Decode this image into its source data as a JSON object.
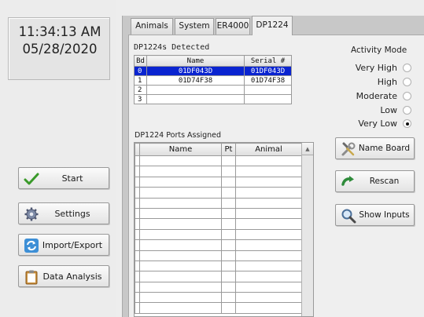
{
  "clock": {
    "time": "11:34:13 AM",
    "date": "05/28/2020"
  },
  "left_buttons": [
    {
      "label": "Start",
      "icon": "check-icon"
    },
    {
      "label": "Settings",
      "icon": "gear-icon"
    },
    {
      "label": "Import/Export",
      "icon": "sync-icon"
    },
    {
      "label": "Data Analysis",
      "icon": "clipboard-icon"
    }
  ],
  "tabs": [
    {
      "label": "Animals"
    },
    {
      "label": "System"
    },
    {
      "label": "ER4000"
    },
    {
      "label": "DP1224",
      "active": true
    }
  ],
  "detected": {
    "title": "DP1224s Detected",
    "headers": [
      "Bd",
      "Name",
      "Serial #"
    ],
    "rows": [
      {
        "bd": "0",
        "name": "01DF043D",
        "serial": "01DF043D",
        "selected": true
      },
      {
        "bd": "1",
        "name": "01D74F38",
        "serial": "01D74F38"
      },
      {
        "bd": "2",
        "name": "",
        "serial": ""
      },
      {
        "bd": "3",
        "name": "",
        "serial": ""
      }
    ]
  },
  "ports": {
    "title": "DP1224 Ports Assigned",
    "headers": [
      "Name",
      "Pt",
      "Animal"
    ]
  },
  "activity_mode": {
    "title": "Activity Mode",
    "options": [
      "Very High",
      "High",
      "Moderate",
      "Low",
      "Very Low"
    ],
    "selected": "Very Low"
  },
  "right_buttons": [
    {
      "label": "Name Board",
      "icon": "tools-icon"
    },
    {
      "label": "Rescan",
      "icon": "arrow-right-icon"
    },
    {
      "label": "Show Inputs",
      "icon": "magnifier-icon"
    }
  ],
  "colors": {
    "selection": "#0a24d0",
    "check": "#3a9a2a",
    "rescan_arrow": "#2e8b3a"
  }
}
